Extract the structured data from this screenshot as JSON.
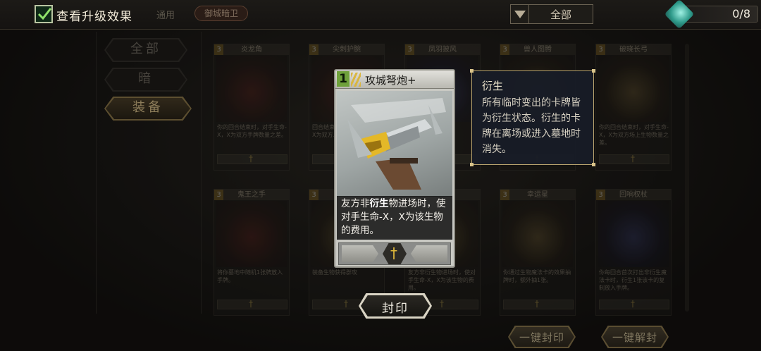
{
  "topbar": {
    "checkbox_label": "查看升级效果",
    "tag_plain": "通用",
    "tag_pill": "御城暗卫",
    "filter_value": "全部",
    "counter": "0/8"
  },
  "categories": [
    {
      "label": "全部"
    },
    {
      "label": "暗"
    },
    {
      "label": "装备"
    }
  ],
  "cards": [
    {
      "cost": "3",
      "name": "炎龙角",
      "desc": "你的回合结束时，对手生命-X，X为双方手牌数量之差。"
    },
    {
      "cost": "3",
      "name": "尖刺护腕",
      "desc": "回合结束时，对手生命-X，X为双方…到伤害…"
    },
    {
      "cost": "3",
      "name": "凤羽披风",
      "desc": "…穿透"
    },
    {
      "cost": "3",
      "name": "兽人图腾",
      "desc": ""
    },
    {
      "cost": "3",
      "name": "破晓长弓",
      "desc": "你的回合结束时，对手生命-X，X为双方场上生物数量之差。"
    },
    {
      "cost": "3",
      "name": "鬼王之手",
      "desc": "将你墓地中随机1张牌放入手牌。"
    },
    {
      "cost": "3",
      "name": "大…",
      "desc": "装备生物获得群攻"
    },
    {
      "cost": "3",
      "name": "",
      "desc": "友方非衍生物进场时，使对手生命-X，X为该生物的费用。"
    },
    {
      "cost": "3",
      "name": "幸运星",
      "desc": "你通过生物魔法卡的效果抽牌时，额外抽1张。"
    },
    {
      "cost": "3",
      "name": "回响权杖",
      "desc": "你每回合首次打出非衍生魔法卡时，衍生1张该卡的复制放入手牌。"
    }
  ],
  "detail": {
    "cost": "1",
    "title": "攻城弩炮+",
    "text_prefix": "友方非",
    "text_bold": "衍生",
    "text_suffix": "物进场时，使对手生命-X，X为该生物的费用。"
  },
  "tooltip": {
    "title": "衍生",
    "body": "所有临时变出的卡牌皆为衍生状态。衍生的卡牌在离场或进入墓地时消失。"
  },
  "buttons": {
    "seal": "封印",
    "seal_all": "一键封印",
    "unseal_all": "一键解封"
  }
}
